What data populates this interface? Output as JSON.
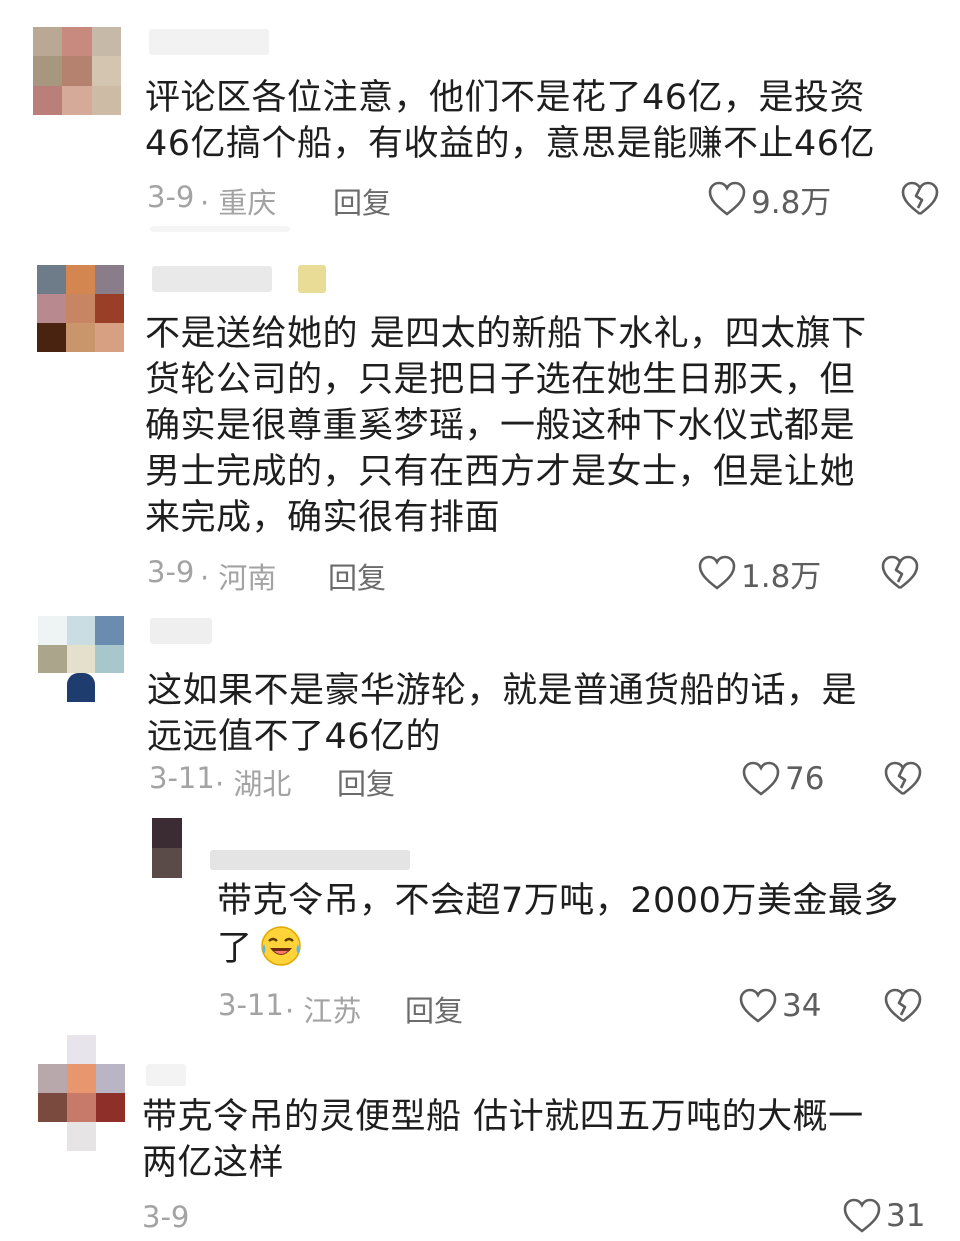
{
  "comments": [
    {
      "text_lines": [
        "评论区各位注意，他们不是花了46亿，是投资",
        "46亿搞个船，有收益的，意思是能赚不止46亿"
      ],
      "date": "3-9",
      "location": "· 重庆",
      "reply": "回复",
      "likes": "9.8万"
    },
    {
      "text_lines": [
        "不是送给她的 是四太的新船下水礼，四太旗下",
        "货轮公司的，只是把日子选在她生日那天，但",
        "确实是很尊重奚梦瑶，一般这种下水仪式都是",
        "男士完成的，只有在西方才是女士，但是让她",
        "来完成，确实很有排面"
      ],
      "date": "3-9",
      "location": "· 河南",
      "reply": "回复",
      "likes": "1.8万"
    },
    {
      "text_lines": [
        "这如果不是豪华游轮，就是普通货船的话，是",
        "远远值不了46亿的"
      ],
      "date": "3-11",
      "location": "· 湖北",
      "reply": "回复",
      "likes": "76"
    },
    {
      "text_lines": [
        "带克令吊，不会超7万吨，2000万美金最多",
        "了"
      ],
      "date": "3-11",
      "location": "· 江苏",
      "reply": "回复",
      "likes": "34"
    },
    {
      "text_lines": [
        "带克令吊的灵便型船 估计就四五万吨的大概一",
        "两亿这样"
      ],
      "date": "3-9",
      "likes": "31"
    }
  ],
  "icons": {
    "like": "heart-outline-icon",
    "dislike": "broken-heart-icon",
    "emoji": "laugh-cry-emoji"
  },
  "colors": {
    "text": "#1e1e1e",
    "meta": "#a3a3a3",
    "reply": "#6b6b6b",
    "icon": "#5e5e5e"
  }
}
